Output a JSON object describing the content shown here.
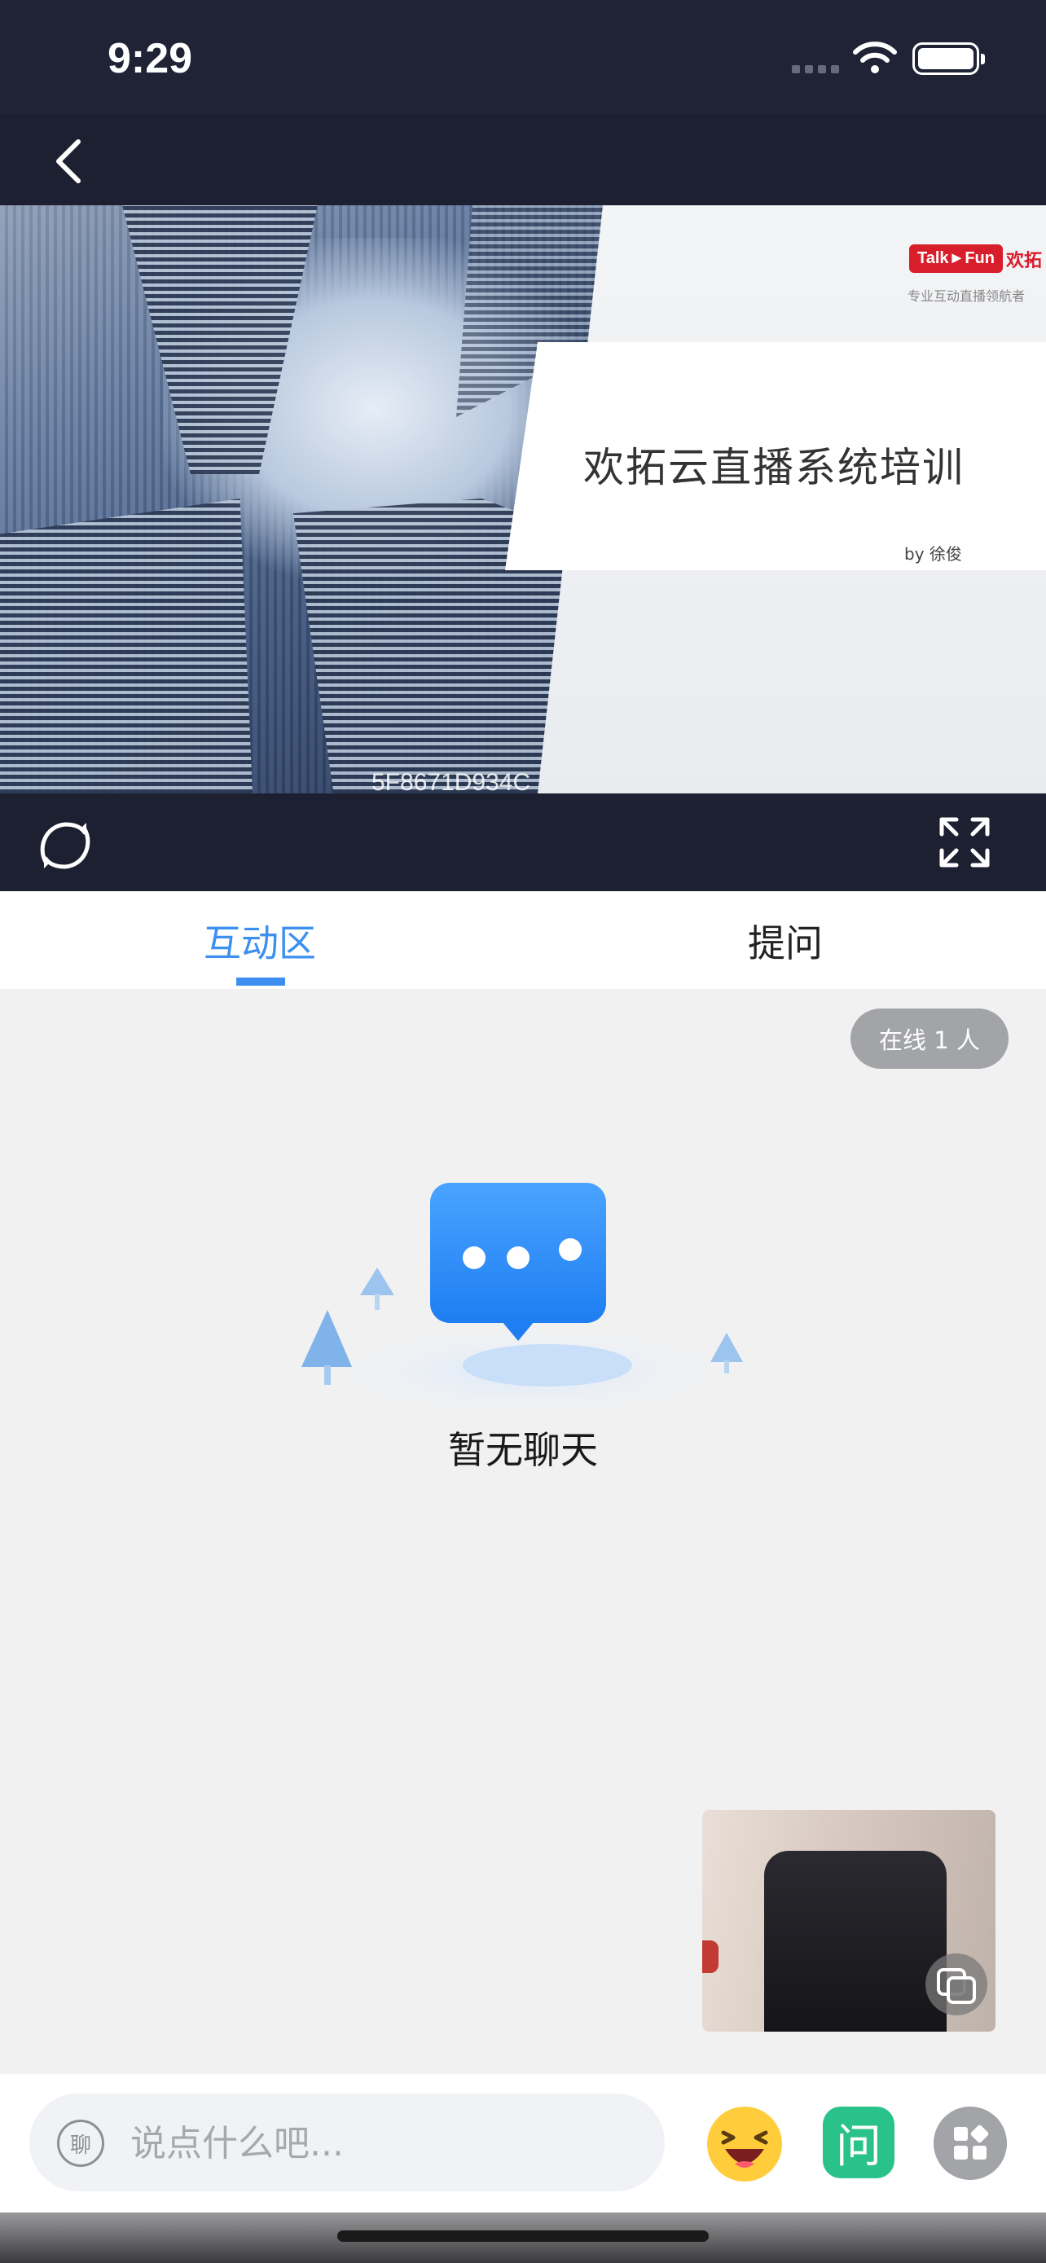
{
  "status_bar": {
    "time": "9:29"
  },
  "video": {
    "slide_title": "欢拓云直播系统培训",
    "slide_author": "by 徐俊",
    "logo_badge": "Talk►Fun",
    "logo_cn": "欢拓",
    "logo_subtitle": "专业互动直播领航者",
    "watermark": "5F8671D934C"
  },
  "tabs": [
    {
      "label": "互动区",
      "active": true
    },
    {
      "label": "提问",
      "active": false
    }
  ],
  "chat": {
    "online_badge": "在线 1 人",
    "empty_text": "暂无聊天"
  },
  "input_bar": {
    "mode_label": "聊",
    "placeholder": "说点什么吧...",
    "ask_label": "问"
  },
  "colors": {
    "accent": "#3d8ff0",
    "header_bg": "#1d2031",
    "ask_green": "#28c28a"
  },
  "icons": [
    "back-icon",
    "wifi-icon",
    "battery-icon",
    "rotate-icon",
    "fullscreen-icon",
    "chat-bubble-icon",
    "camera-switch-icon",
    "emoji-icon",
    "apps-grid-icon"
  ]
}
